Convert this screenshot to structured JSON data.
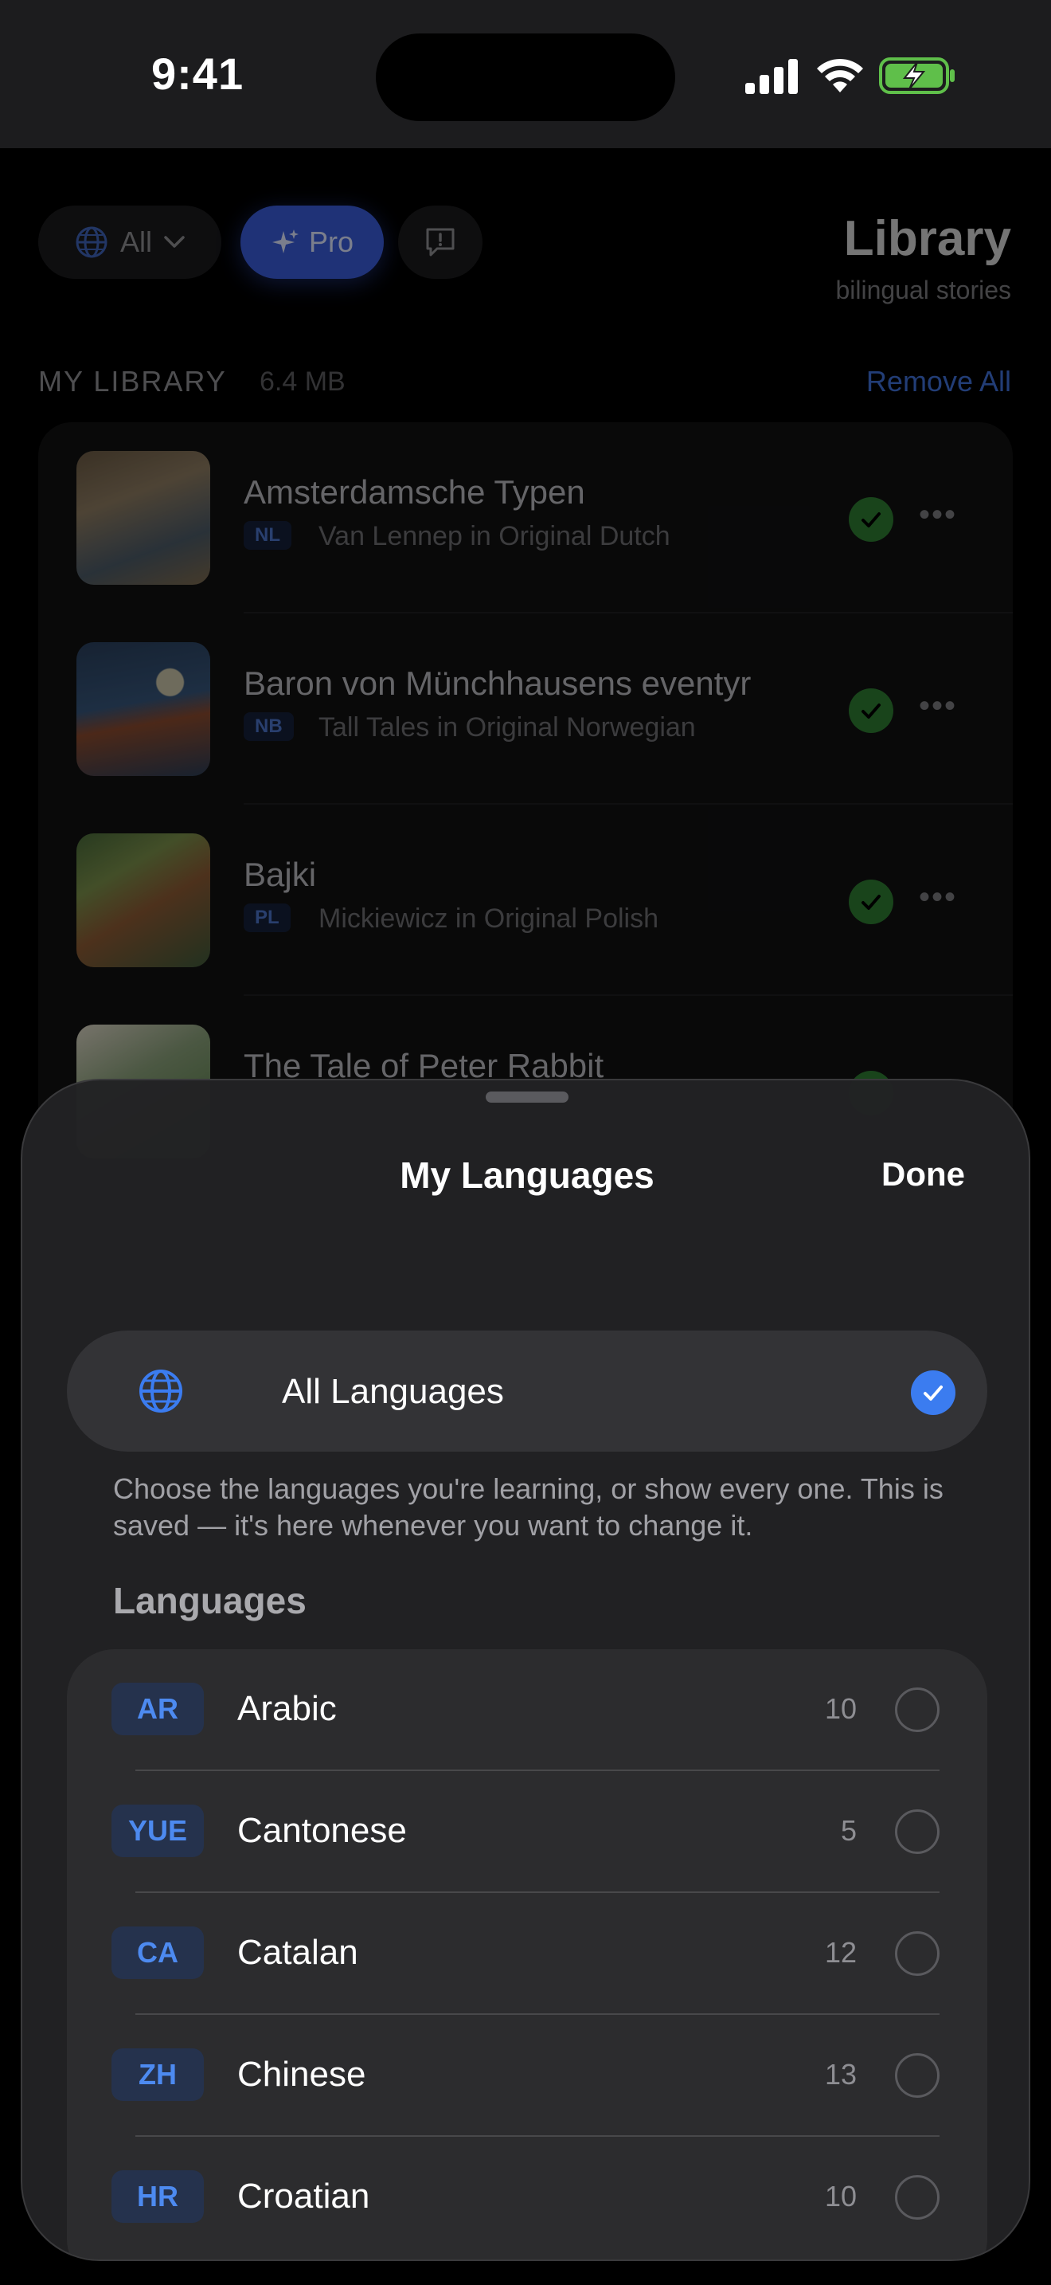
{
  "status_bar": {
    "time": "9:41"
  },
  "library": {
    "filter_all": "All",
    "filter_pro": "Pro",
    "title": "Library",
    "subtitle": "bilingual stories",
    "section_label": "MY LIBRARY",
    "section_size": "6.4 MB",
    "remove_all": "Remove All",
    "books": [
      {
        "title": "Amsterdamsche Typen",
        "code": "NL",
        "subtitle": "Van Lennep in Original Dutch"
      },
      {
        "title": "Baron von Münchhausens eventyr",
        "code": "NB",
        "subtitle": "Tall Tales in Original Norwegian"
      },
      {
        "title": "Bajki",
        "code": "PL",
        "subtitle": "Mickiewicz in Original Polish"
      },
      {
        "title": "The Tale of Peter Rabbit",
        "code": "",
        "subtitle": ""
      }
    ]
  },
  "sheet": {
    "title": "My Languages",
    "done": "Done",
    "all_languages": "All Languages",
    "help_text": "Choose the languages you're learning, or show every one. This is saved — it's here whenever you want to change it.",
    "languages_header": "Languages",
    "languages": [
      {
        "code": "AR",
        "name": "Arabic",
        "count": "10"
      },
      {
        "code": "YUE",
        "name": "Cantonese",
        "count": "5"
      },
      {
        "code": "CA",
        "name": "Catalan",
        "count": "12"
      },
      {
        "code": "ZH",
        "name": "Chinese",
        "count": "13"
      },
      {
        "code": "HR",
        "name": "Croatian",
        "count": "10"
      }
    ]
  },
  "colors": {
    "accent_blue": "#3b7cf0",
    "downloaded_green": "#2e7d32",
    "pro_pill": "#3a5bd9"
  }
}
